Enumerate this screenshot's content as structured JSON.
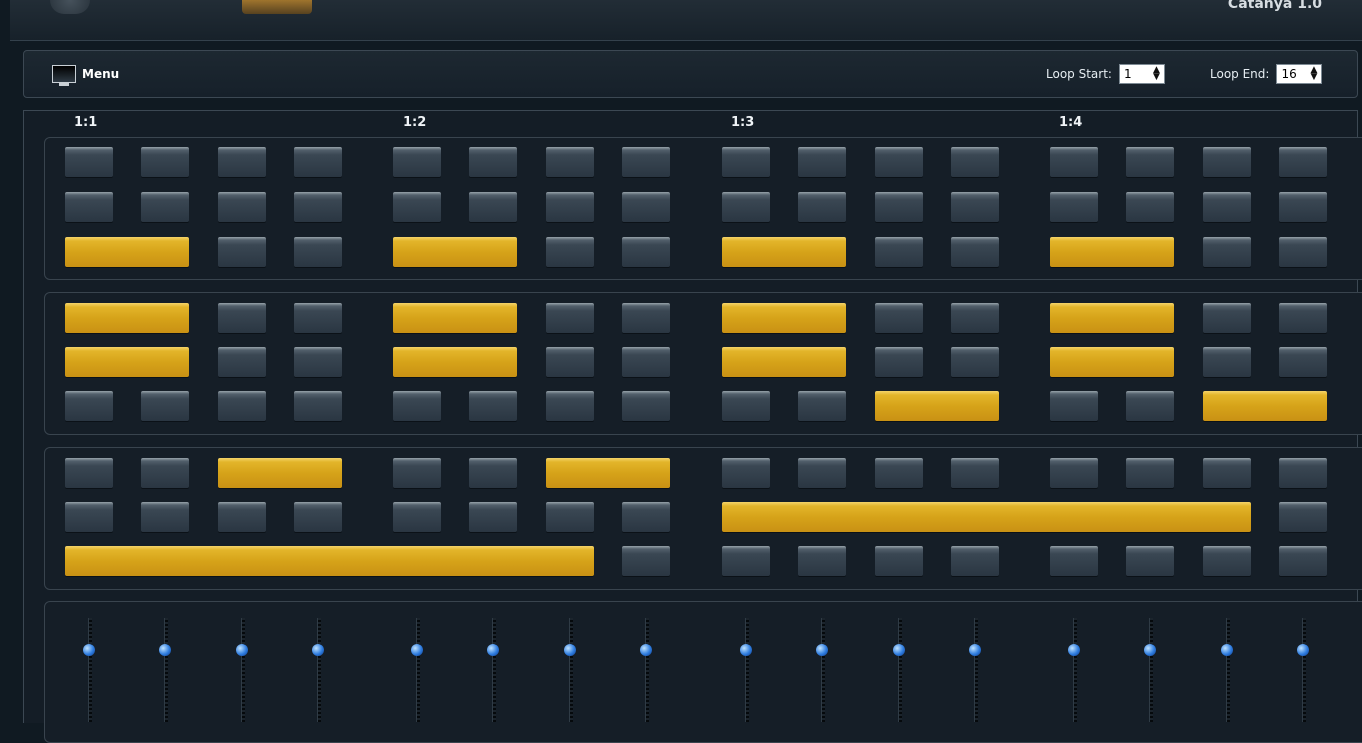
{
  "app": {
    "title": "Catanya 1.0"
  },
  "toolbar": {
    "menu_label": "Menu",
    "loop_start_label": "Loop Start:",
    "loop_start_value": "1",
    "loop_end_label": "Loop End:",
    "loop_end_value": "16"
  },
  "bars": [
    "1:1",
    "1:2",
    "1:3",
    "1:4"
  ],
  "colors": {
    "pad_on": "#d6a319",
    "pad_off": "#3a4753",
    "knob": "#2f7de0",
    "background": "#101a22"
  },
  "icons": {
    "menu": "monitor-icon",
    "spinner": "updown-arrows-icon"
  },
  "tracks": [
    [
      [
        0,
        1,
        2,
        3,
        4,
        5,
        6,
        7,
        8,
        9,
        10,
        11,
        12,
        13,
        14,
        15
      ]
    ],
    [
      [
        0,
        1,
        2,
        3,
        4,
        5,
        6,
        7,
        8,
        9,
        10,
        11,
        12,
        13,
        14,
        15
      ]
    ],
    [
      [
        0,
        1,
        "on",
        2,
        3,
        4,
        5,
        "on",
        6,
        7,
        8,
        9,
        "on",
        10,
        11,
        12,
        13,
        "on",
        14,
        15
      ]
    ]
  ],
  "sequence": {
    "steps_per_row": 16,
    "groups": [
      {
        "rows": [
          {
            "notes": []
          },
          {
            "notes": []
          },
          {
            "notes": [
              [
                0,
                2
              ],
              [
                4,
                2
              ],
              [
                8,
                2
              ],
              [
                12,
                2
              ]
            ]
          }
        ]
      },
      {
        "rows": [
          {
            "notes": [
              [
                0,
                2
              ],
              [
                4,
                2
              ],
              [
                8,
                2
              ],
              [
                12,
                2
              ]
            ]
          },
          {
            "notes": [
              [
                0,
                2
              ],
              [
                4,
                2
              ],
              [
                8,
                2
              ],
              [
                12,
                2
              ]
            ]
          },
          {
            "notes": [
              [
                10,
                2
              ],
              [
                14,
                2
              ]
            ]
          }
        ]
      },
      {
        "rows": [
          {
            "notes": [
              [
                2,
                2
              ],
              [
                6,
                2
              ]
            ]
          },
          {
            "notes": [
              [
                8,
                7
              ]
            ]
          },
          {
            "notes": [
              [
                0,
                7
              ]
            ]
          }
        ]
      }
    ]
  },
  "sliders": {
    "count": 16,
    "level": 0.3
  }
}
